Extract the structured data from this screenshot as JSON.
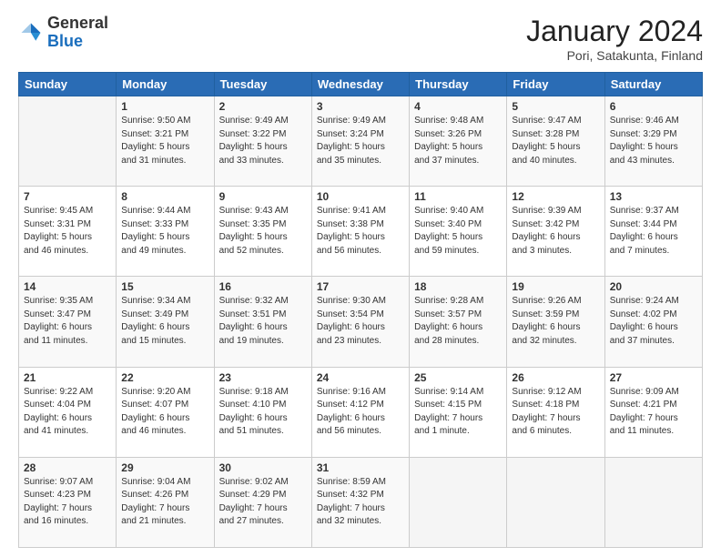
{
  "header": {
    "logo_general": "General",
    "logo_blue": "Blue",
    "month": "January 2024",
    "location": "Pori, Satakunta, Finland"
  },
  "weekdays": [
    "Sunday",
    "Monday",
    "Tuesday",
    "Wednesday",
    "Thursday",
    "Friday",
    "Saturday"
  ],
  "weeks": [
    [
      {
        "day": "",
        "info": ""
      },
      {
        "day": "1",
        "info": "Sunrise: 9:50 AM\nSunset: 3:21 PM\nDaylight: 5 hours\nand 31 minutes."
      },
      {
        "day": "2",
        "info": "Sunrise: 9:49 AM\nSunset: 3:22 PM\nDaylight: 5 hours\nand 33 minutes."
      },
      {
        "day": "3",
        "info": "Sunrise: 9:49 AM\nSunset: 3:24 PM\nDaylight: 5 hours\nand 35 minutes."
      },
      {
        "day": "4",
        "info": "Sunrise: 9:48 AM\nSunset: 3:26 PM\nDaylight: 5 hours\nand 37 minutes."
      },
      {
        "day": "5",
        "info": "Sunrise: 9:47 AM\nSunset: 3:28 PM\nDaylight: 5 hours\nand 40 minutes."
      },
      {
        "day": "6",
        "info": "Sunrise: 9:46 AM\nSunset: 3:29 PM\nDaylight: 5 hours\nand 43 minutes."
      }
    ],
    [
      {
        "day": "7",
        "info": "Sunrise: 9:45 AM\nSunset: 3:31 PM\nDaylight: 5 hours\nand 46 minutes."
      },
      {
        "day": "8",
        "info": "Sunrise: 9:44 AM\nSunset: 3:33 PM\nDaylight: 5 hours\nand 49 minutes."
      },
      {
        "day": "9",
        "info": "Sunrise: 9:43 AM\nSunset: 3:35 PM\nDaylight: 5 hours\nand 52 minutes."
      },
      {
        "day": "10",
        "info": "Sunrise: 9:41 AM\nSunset: 3:38 PM\nDaylight: 5 hours\nand 56 minutes."
      },
      {
        "day": "11",
        "info": "Sunrise: 9:40 AM\nSunset: 3:40 PM\nDaylight: 5 hours\nand 59 minutes."
      },
      {
        "day": "12",
        "info": "Sunrise: 9:39 AM\nSunset: 3:42 PM\nDaylight: 6 hours\nand 3 minutes."
      },
      {
        "day": "13",
        "info": "Sunrise: 9:37 AM\nSunset: 3:44 PM\nDaylight: 6 hours\nand 7 minutes."
      }
    ],
    [
      {
        "day": "14",
        "info": "Sunrise: 9:35 AM\nSunset: 3:47 PM\nDaylight: 6 hours\nand 11 minutes."
      },
      {
        "day": "15",
        "info": "Sunrise: 9:34 AM\nSunset: 3:49 PM\nDaylight: 6 hours\nand 15 minutes."
      },
      {
        "day": "16",
        "info": "Sunrise: 9:32 AM\nSunset: 3:51 PM\nDaylight: 6 hours\nand 19 minutes."
      },
      {
        "day": "17",
        "info": "Sunrise: 9:30 AM\nSunset: 3:54 PM\nDaylight: 6 hours\nand 23 minutes."
      },
      {
        "day": "18",
        "info": "Sunrise: 9:28 AM\nSunset: 3:57 PM\nDaylight: 6 hours\nand 28 minutes."
      },
      {
        "day": "19",
        "info": "Sunrise: 9:26 AM\nSunset: 3:59 PM\nDaylight: 6 hours\nand 32 minutes."
      },
      {
        "day": "20",
        "info": "Sunrise: 9:24 AM\nSunset: 4:02 PM\nDaylight: 6 hours\nand 37 minutes."
      }
    ],
    [
      {
        "day": "21",
        "info": "Sunrise: 9:22 AM\nSunset: 4:04 PM\nDaylight: 6 hours\nand 41 minutes."
      },
      {
        "day": "22",
        "info": "Sunrise: 9:20 AM\nSunset: 4:07 PM\nDaylight: 6 hours\nand 46 minutes."
      },
      {
        "day": "23",
        "info": "Sunrise: 9:18 AM\nSunset: 4:10 PM\nDaylight: 6 hours\nand 51 minutes."
      },
      {
        "day": "24",
        "info": "Sunrise: 9:16 AM\nSunset: 4:12 PM\nDaylight: 6 hours\nand 56 minutes."
      },
      {
        "day": "25",
        "info": "Sunrise: 9:14 AM\nSunset: 4:15 PM\nDaylight: 7 hours\nand 1 minute."
      },
      {
        "day": "26",
        "info": "Sunrise: 9:12 AM\nSunset: 4:18 PM\nDaylight: 7 hours\nand 6 minutes."
      },
      {
        "day": "27",
        "info": "Sunrise: 9:09 AM\nSunset: 4:21 PM\nDaylight: 7 hours\nand 11 minutes."
      }
    ],
    [
      {
        "day": "28",
        "info": "Sunrise: 9:07 AM\nSunset: 4:23 PM\nDaylight: 7 hours\nand 16 minutes."
      },
      {
        "day": "29",
        "info": "Sunrise: 9:04 AM\nSunset: 4:26 PM\nDaylight: 7 hours\nand 21 minutes."
      },
      {
        "day": "30",
        "info": "Sunrise: 9:02 AM\nSunset: 4:29 PM\nDaylight: 7 hours\nand 27 minutes."
      },
      {
        "day": "31",
        "info": "Sunrise: 8:59 AM\nSunset: 4:32 PM\nDaylight: 7 hours\nand 32 minutes."
      },
      {
        "day": "",
        "info": ""
      },
      {
        "day": "",
        "info": ""
      },
      {
        "day": "",
        "info": ""
      }
    ]
  ]
}
